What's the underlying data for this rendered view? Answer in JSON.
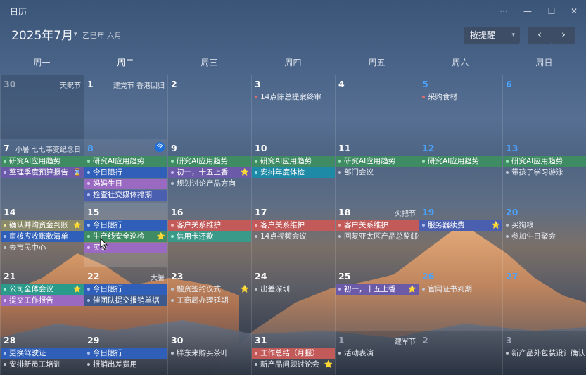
{
  "app": {
    "title": "日历"
  },
  "window": {
    "more": "···",
    "minimize": "—",
    "maximize": "☐",
    "close": "✕"
  },
  "header": {
    "month": "2025年7月",
    "lunar": "乙巳年 六月",
    "remind": "按提醒",
    "prev": "‹",
    "next": "›"
  },
  "weekdays": [
    "周一",
    "周二",
    "周三",
    "周四",
    "周五",
    "周六",
    "周日"
  ],
  "today_badge": "今",
  "weeks": [
    [
      {
        "d": "30",
        "other": true,
        "tag": "天贶节",
        "events": []
      },
      {
        "d": "1",
        "tag": "建党节 香港回归",
        "events": []
      },
      {
        "d": "2",
        "events": []
      },
      {
        "d": "3",
        "events": [
          {
            "t": "14点陈总提案终审",
            "dot": "#e06c6c"
          }
        ]
      },
      {
        "d": "4",
        "events": []
      },
      {
        "d": "5",
        "weekend": true,
        "events": [
          {
            "t": "采购食材",
            "dot": "#e06c6c"
          }
        ]
      },
      {
        "d": "6",
        "weekend": true,
        "events": []
      }
    ],
    [
      {
        "d": "7",
        "tag": "小暑 七七事变纪念日",
        "events": [
          {
            "t": "研究AI应用趋势",
            "bg": "#3f8c64",
            "dot": "#9ee0b8"
          },
          {
            "t": "整理季度预算报告",
            "bg": "#6a5aa8",
            "dot": "#c8bdf2",
            "mark": "⌛"
          }
        ]
      },
      {
        "d": "8",
        "weekend": true,
        "today": true,
        "events": [
          {
            "t": "研究AI应用趋势",
            "bg": "#3f8c64",
            "dot": "#9ee0b8"
          },
          {
            "t": "今日限行",
            "bg": "#2f5fb8",
            "dot": "#a9c4f2"
          },
          {
            "t": "妈妈生日",
            "bg": "#9a6ac2",
            "dot": "#e2c7f5"
          },
          {
            "t": "检查社交媒体排期",
            "bg": "#4a5fb0",
            "dot": "#b3c0f0"
          }
        ]
      },
      {
        "d": "9",
        "events": [
          {
            "t": "研究AI应用趋势",
            "bg": "#3f8c64",
            "dot": "#9ee0b8"
          },
          {
            "t": "初一，十五上香",
            "bg": "#6a5aa8",
            "dot": "#c8bdf2",
            "mark": "⭐"
          },
          {
            "t": "规划讨论产品方向",
            "dot": "#c0c6d0"
          }
        ]
      },
      {
        "d": "10",
        "events": [
          {
            "t": "研究AI应用趋势",
            "bg": "#3f8c64",
            "dot": "#9ee0b8"
          },
          {
            "t": "安排年度体检",
            "bg": "#1f8aa6",
            "dot": "#9fe0f0"
          }
        ]
      },
      {
        "d": "11",
        "events": [
          {
            "t": "研究AI应用趋势",
            "bg": "#3f8c64",
            "dot": "#9ee0b8"
          },
          {
            "t": "部门会议",
            "dot": "#c0c6d0"
          }
        ]
      },
      {
        "d": "12",
        "weekend": true,
        "events": [
          {
            "t": "研究AI应用趋势",
            "bg": "#3f8c64",
            "dot": "#9ee0b8"
          }
        ]
      },
      {
        "d": "13",
        "weekend": true,
        "events": [
          {
            "t": "研究AI应用趋势",
            "bg": "#3f8c64",
            "dot": "#9ee0b8"
          },
          {
            "t": "带孩子学习游泳",
            "dot": "#c0c6d0"
          }
        ]
      }
    ],
    [
      {
        "d": "14",
        "events": [
          {
            "t": "确认并购资金到账",
            "bg": "#8a8a6a",
            "dot": "#f0e6a0",
            "mark": "⭐"
          },
          {
            "t": "审核应收账款清单",
            "bg": "#2f5fb8",
            "dot": "#a9c4f2"
          },
          {
            "t": "去市民中心",
            "dot": "#c0c6d0"
          }
        ]
      },
      {
        "d": "15",
        "selected": true,
        "events": [
          {
            "t": "今日限行",
            "bg": "#2f5fb8",
            "dot": "#a9c4f2"
          },
          {
            "t": "生产线安全巡检",
            "bg": "#3f8c64",
            "dot": "#9ee0b8",
            "mark": "⭐"
          },
          {
            "t": "买菜",
            "bg": "#9a6ac2",
            "dot": "#e2c7f5"
          }
        ]
      },
      {
        "d": "16",
        "events": [
          {
            "t": "客户关系维护",
            "bg": "#c25a5a",
            "dot": "#f3b8b8"
          },
          {
            "t": "信用卡还款",
            "bg": "#3a9a8a",
            "dot": "#a8ecd8"
          }
        ]
      },
      {
        "d": "17",
        "events": [
          {
            "t": "客户关系维护",
            "bg": "#c25a5a",
            "dot": "#f3b8b8"
          },
          {
            "t": "14点视频会议",
            "dot": "#c0c6d0"
          }
        ]
      },
      {
        "d": "18",
        "tag": "火把节",
        "events": [
          {
            "t": "客户关系维护",
            "bg": "#c25a5a",
            "dot": "#f3b8b8"
          },
          {
            "t": "回复亚太区产品总监邮件",
            "dot": "#c0c6d0"
          }
        ]
      },
      {
        "d": "19",
        "weekend": true,
        "events": [
          {
            "t": "服务器续费",
            "bg": "#4a5fb0",
            "dot": "#b3c0f0",
            "mark": "⭐"
          }
        ]
      },
      {
        "d": "20",
        "weekend": true,
        "events": [
          {
            "t": "买狗粮",
            "dot": "#c0c6d0"
          },
          {
            "t": "参加生日聚会",
            "dot": "#c0c6d0"
          }
        ]
      }
    ],
    [
      {
        "d": "21",
        "events": [
          {
            "t": "公司全体会议",
            "bg": "#2a9a8a",
            "dot": "#a8ecd8",
            "mark": "⭐"
          },
          {
            "t": "提交工作报告",
            "bg": "#9a6ac2",
            "dot": "#e2c7f5"
          }
        ]
      },
      {
        "d": "22",
        "tag": "大暑",
        "events": [
          {
            "t": "今日限行",
            "bg": "#2f5fb8",
            "dot": "#a9c4f2"
          },
          {
            "t": "催团队提交报销单据",
            "bg": "#3e5a8c",
            "dot": "#b3c0f0"
          }
        ]
      },
      {
        "d": "23",
        "events": [
          {
            "t": "融资签约仪式",
            "dot": "#c0c6d0",
            "mark": "⭐"
          },
          {
            "t": "工商局办理延期",
            "dot": "#c0c6d0"
          }
        ]
      },
      {
        "d": "24",
        "events": [
          {
            "t": "出差深圳",
            "dot": "#c0c6d0"
          }
        ]
      },
      {
        "d": "25",
        "events": [
          {
            "t": "初一，十五上香",
            "bg": "#6a5aa8",
            "dot": "#c8bdf2",
            "mark": "⭐"
          }
        ]
      },
      {
        "d": "26",
        "weekend": true,
        "events": [
          {
            "t": "官网证书到期",
            "dot": "#c0c6d0"
          }
        ]
      },
      {
        "d": "27",
        "weekend": true,
        "events": []
      }
    ],
    [
      {
        "d": "28",
        "events": [
          {
            "t": "更换驾驶证",
            "bg": "#2f5fb8",
            "dot": "#a9c4f2"
          },
          {
            "t": "安排新员工培训",
            "dot": "#c0c6d0"
          }
        ]
      },
      {
        "d": "29",
        "events": [
          {
            "t": "今日限行",
            "bg": "#2f5fb8",
            "dot": "#a9c4f2"
          },
          {
            "t": "报销出差费用",
            "dot": "#c0c6d0"
          }
        ]
      },
      {
        "d": "30",
        "events": [
          {
            "t": "胖东来购买茶叶",
            "dot": "#c0c6d0"
          }
        ]
      },
      {
        "d": "31",
        "events": [
          {
            "t": "工作总结（月报）",
            "bg": "#c25a5a",
            "dot": "#f3b8b8"
          },
          {
            "t": "新产品问题讨论会",
            "dot": "#c0c6d0",
            "mark": "⭐"
          }
        ]
      },
      {
        "d": "1",
        "other": true,
        "tag": "建军节",
        "events": [
          {
            "t": "活动表演",
            "dot": "#c0c6d0"
          }
        ]
      },
      {
        "d": "2",
        "other": true,
        "weekend": true,
        "events": []
      },
      {
        "d": "3",
        "other": true,
        "weekend": true,
        "events": [
          {
            "t": "新产品外包装设计确认",
            "dot": "#c0c6d0"
          }
        ]
      }
    ]
  ]
}
